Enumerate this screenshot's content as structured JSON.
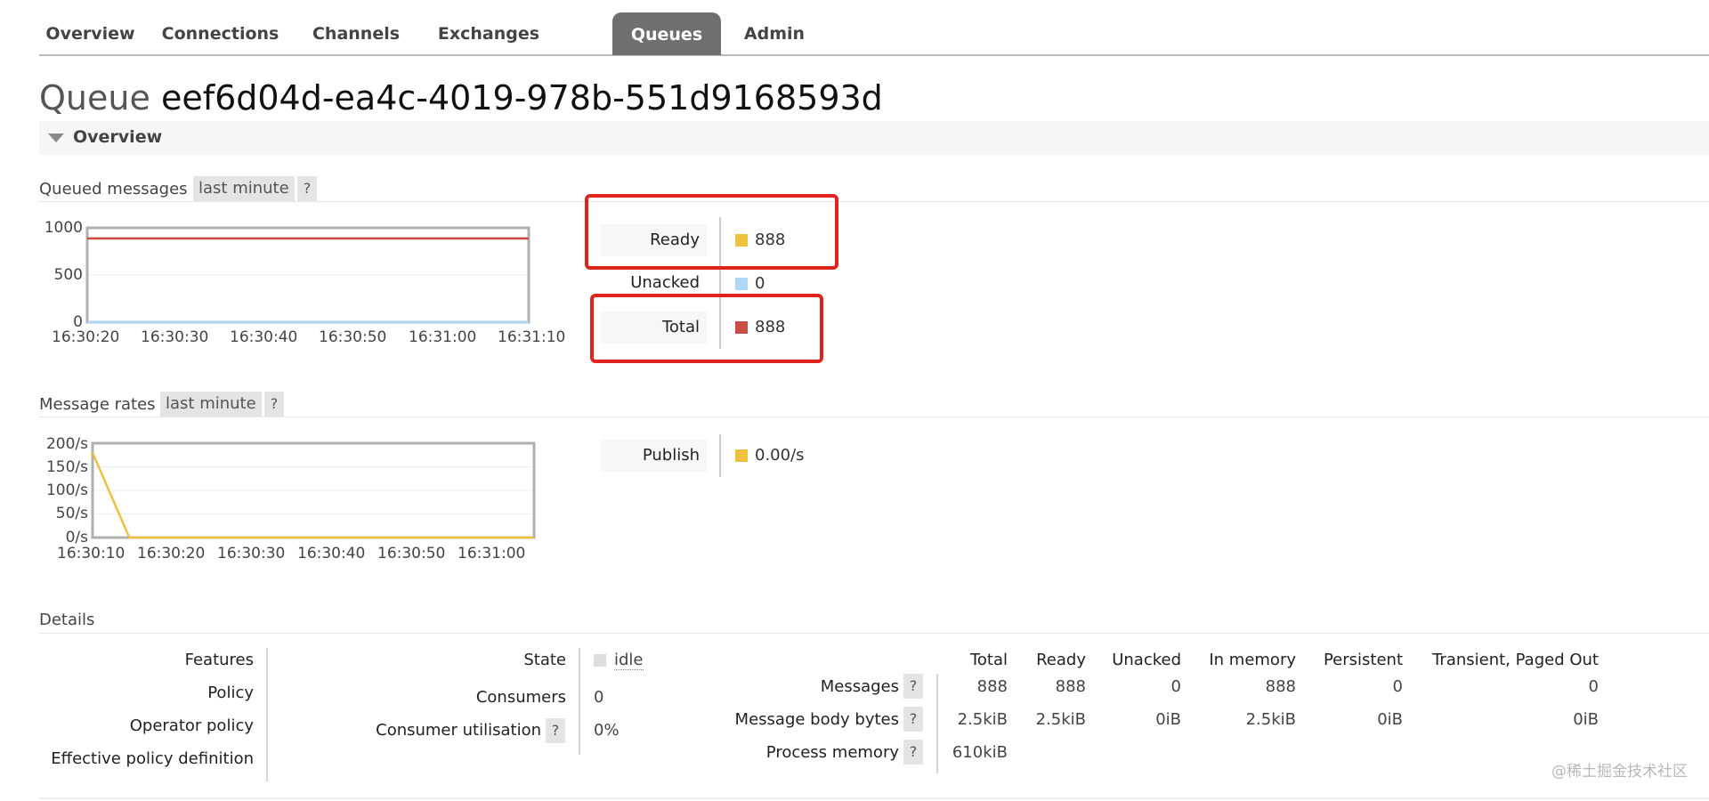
{
  "tabs": [
    {
      "label": "Overview",
      "active": false
    },
    {
      "label": "Connections",
      "active": false
    },
    {
      "label": "Channels",
      "active": false
    },
    {
      "label": "Exchanges",
      "active": false
    },
    {
      "label": "Queues",
      "active": true
    },
    {
      "label": "Admin",
      "active": false
    }
  ],
  "page": {
    "title_prefix": "Queue",
    "queue_name": "eef6d04d-ea4c-4019-978b-551d9168593d"
  },
  "section": {
    "label": "Overview",
    "collapse_icon": "triangle-down-icon"
  },
  "queued_messages": {
    "heading": "Queued messages",
    "range": "last minute",
    "help": "?",
    "legend": [
      {
        "label": "Ready",
        "value": "888",
        "color": "#edc240"
      },
      {
        "label": "Unacked",
        "value": "0",
        "color": "#afd8f8"
      },
      {
        "label": "Total",
        "value": "888",
        "color": "#cb4b4b"
      }
    ]
  },
  "message_rates": {
    "heading": "Message rates",
    "range": "last minute",
    "help": "?",
    "legend": [
      {
        "label": "Publish",
        "value": "0.00/s",
        "color": "#edc240"
      }
    ]
  },
  "chart_data": [
    {
      "type": "line",
      "x": [
        "16:30:15",
        "16:30:20",
        "16:30:30",
        "16:30:40",
        "16:30:50",
        "16:31:00",
        "16:31:10",
        "16:31:15"
      ],
      "xticks": [
        "16:30:20",
        "16:30:30",
        "16:30:40",
        "16:30:50",
        "16:31:00",
        "16:31:10"
      ],
      "yticks": [
        "1000",
        "500",
        "0"
      ],
      "ylim": [
        0,
        1000
      ],
      "series": [
        {
          "name": "Ready",
          "color": "#edc240",
          "values": [
            888,
            888,
            888,
            888,
            888,
            888,
            888,
            888
          ]
        },
        {
          "name": "Unacked",
          "color": "#afd8f8",
          "values": [
            0,
            0,
            0,
            0,
            0,
            0,
            0,
            0
          ]
        },
        {
          "name": "Total",
          "color": "#cb4b4b",
          "values": [
            888,
            888,
            888,
            888,
            888,
            888,
            888,
            888
          ]
        }
      ],
      "grid": true
    },
    {
      "type": "line",
      "x": [
        "16:30:09",
        "16:30:14",
        "16:30:20",
        "16:30:30",
        "16:30:40",
        "16:30:50",
        "16:31:00",
        "16:31:09"
      ],
      "xticks": [
        "16:30:10",
        "16:30:20",
        "16:30:30",
        "16:30:40",
        "16:30:50",
        "16:31:00"
      ],
      "yticks": [
        "200/s",
        "150/s",
        "100/s",
        "50/s",
        "0/s"
      ],
      "ylim": [
        0,
        200
      ],
      "series": [
        {
          "name": "Publish",
          "color": "#edc240",
          "values": [
            180,
            0,
            0,
            0,
            0,
            0,
            0,
            0
          ]
        }
      ],
      "grid": true
    }
  ],
  "details": {
    "heading": "Details",
    "left_labels": [
      "Features",
      "Policy",
      "Operator policy",
      "Effective policy definition"
    ],
    "state": {
      "label": "State",
      "value": "idle"
    },
    "consumers": {
      "label": "Consumers",
      "value": "0"
    },
    "consumer_utilisation": {
      "label": "Consumer utilisation",
      "help": "?",
      "value": "0%"
    },
    "messages_table": {
      "columns": [
        "Total",
        "Ready",
        "Unacked",
        "In memory",
        "Persistent",
        "Transient, Paged Out"
      ],
      "rows": [
        {
          "label": "Messages",
          "help": "?",
          "values": [
            "888",
            "888",
            "0",
            "888",
            "0",
            "0"
          ]
        },
        {
          "label": "Message body bytes",
          "help": "?",
          "values": [
            "2.5kiB",
            "2.5kiB",
            "0iB",
            "2.5kiB",
            "0iB",
            "0iB"
          ]
        },
        {
          "label": "Process memory",
          "help": "?",
          "values": [
            "610kiB"
          ]
        }
      ]
    }
  },
  "watermark": "@稀土掘金技术社区"
}
